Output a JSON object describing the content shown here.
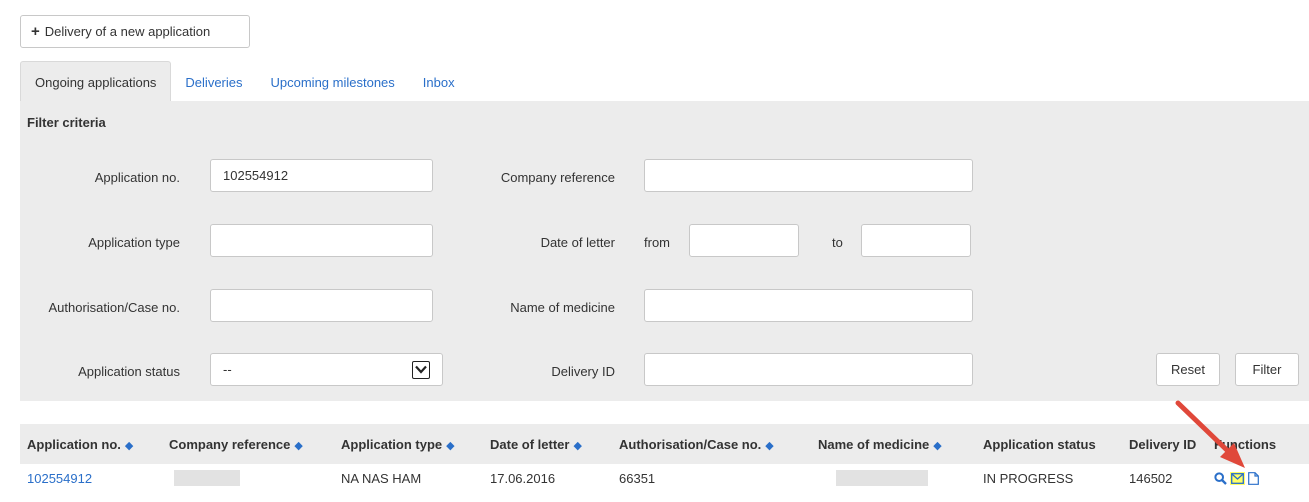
{
  "toolbar": {
    "new_application_label": "Delivery of a new application"
  },
  "tabs": [
    {
      "label": "Ongoing applications"
    },
    {
      "label": "Deliveries"
    },
    {
      "label": "Upcoming milestones"
    },
    {
      "label": "Inbox"
    }
  ],
  "filter": {
    "title": "Filter criteria",
    "application_no_label": "Application no.",
    "application_no_value": "102554912",
    "company_reference_label": "Company reference",
    "company_reference_value": "",
    "application_type_label": "Application type",
    "application_type_value": "",
    "date_of_letter_label": "Date of letter",
    "from_label": "from",
    "from_value": "",
    "to_label": "to",
    "to_value": "",
    "authorisation_label": "Authorisation/Case no.",
    "authorisation_value": "",
    "name_of_medicine_label": "Name of medicine",
    "name_of_medicine_value": "",
    "application_status_label": "Application status",
    "application_status_value": "--",
    "delivery_id_label": "Delivery ID",
    "delivery_id_value": "",
    "reset_label": "Reset",
    "filter_label": "Filter"
  },
  "table": {
    "columns": [
      "Application no.",
      "Company reference",
      "Application type",
      "Date of letter",
      "Authorisation/Case no.",
      "Name of medicine",
      "Application status",
      "Delivery ID",
      "Functions"
    ],
    "rows": [
      {
        "application_no": "102554912",
        "company_reference": "",
        "application_type": "NA NAS HAM",
        "date_of_letter": "17.06.2016",
        "authorisation_no": "66351",
        "name_of_medicine": "",
        "application_status": "IN PROGRESS",
        "delivery_id": "146502"
      }
    ]
  },
  "colors": {
    "link": "#2a6fc9",
    "panel": "#ececec",
    "highlight": "#ffff66",
    "arrow": "#e0483a"
  },
  "icons": [
    "plus-icon",
    "sort-icon",
    "chevron-down-icon",
    "search-icon",
    "envelope-icon",
    "document-icon",
    "red-arrow"
  ]
}
